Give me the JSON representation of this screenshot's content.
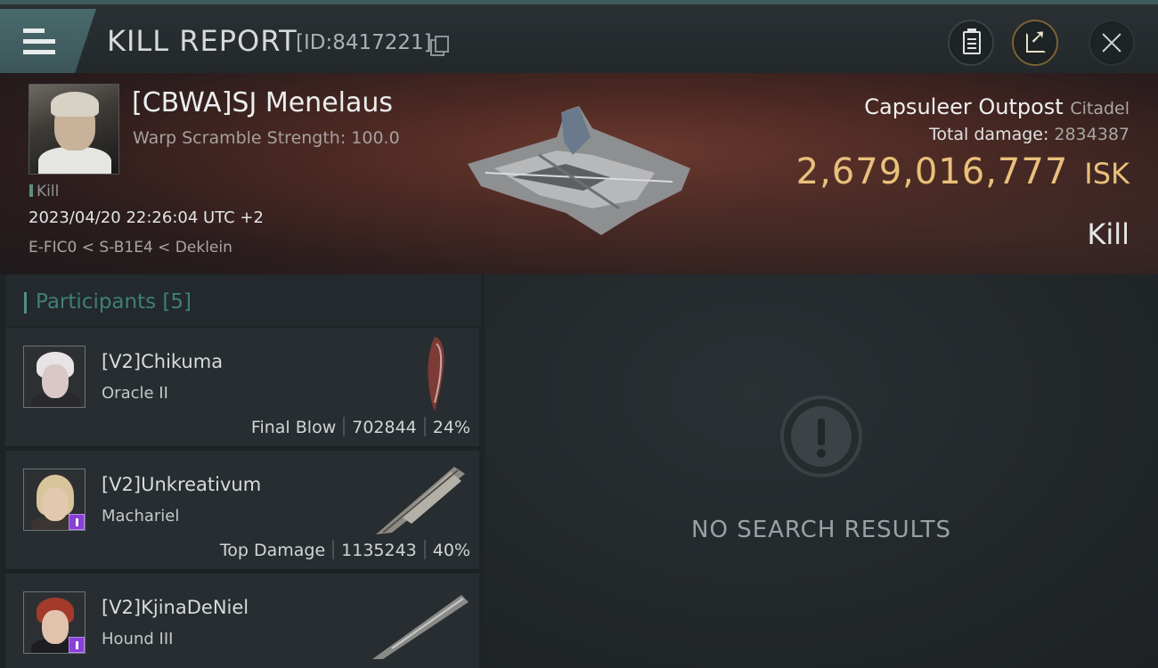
{
  "header": {
    "title": "KILL REPORT",
    "report_id": "[ID:8417221]"
  },
  "victim": {
    "name": "[CBWA]SJ Menelaus",
    "subtitle": "Warp Scramble Strength: 100.0",
    "tag": "Kill",
    "datetime": "2023/04/20 22:26:04 UTC +2",
    "location": "E-FIC0 < S-B1E4 < Deklein"
  },
  "target": {
    "name": "Capsuleer Outpost",
    "class": "Citadel",
    "total_damage_label": "Total damage:",
    "total_damage_value": "2834387",
    "isk_value": "2,679,016,777",
    "isk_unit": "ISK",
    "result": "Kill"
  },
  "participants": {
    "label": "Participants [5]",
    "items": [
      {
        "name": "[V2]Chikuma",
        "ship": "Oracle II",
        "role": "Final Blow",
        "damage": "702844",
        "percent": "24%"
      },
      {
        "name": "[V2]Unkreativum",
        "ship": "Machariel",
        "role": "Top Damage",
        "damage": "1135243",
        "percent": "40%"
      },
      {
        "name": "[V2]KjinaDeNiel",
        "ship": "Hound III",
        "role": "",
        "damage": "",
        "percent": ""
      }
    ]
  },
  "results": {
    "empty_text": "NO SEARCH RESULTS"
  },
  "colors": {
    "accent_teal": "#4f8e86",
    "isk_gold": "#e9c07a",
    "badge_purple": "#8a3fd6"
  }
}
